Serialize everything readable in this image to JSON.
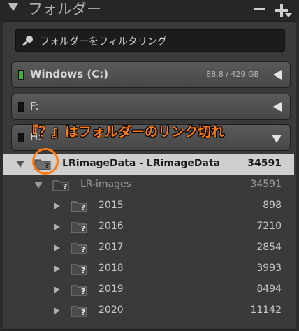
{
  "header": {
    "title": "フォルダー"
  },
  "search": {
    "placeholder": "フォルダーをフィルタリング"
  },
  "volumes": [
    {
      "name": "Windows (C:)",
      "size": "88.8 / 429 GB",
      "online": true
    },
    {
      "name": "F:",
      "size": "",
      "online": false
    },
    {
      "name": "H:",
      "size": "",
      "online": false
    }
  ],
  "annotation": "『？』はフォルダーのリンク切れ",
  "tree": {
    "root": {
      "label": "LRimageData - LRimageData",
      "count": "34591"
    },
    "sub": {
      "label": "LR-images",
      "count": "34591"
    },
    "years": [
      {
        "label": "2015",
        "count": "898"
      },
      {
        "label": "2016",
        "count": "7210"
      },
      {
        "label": "2017",
        "count": "2854"
      },
      {
        "label": "2018",
        "count": "3993"
      },
      {
        "label": "2019",
        "count": "8494"
      },
      {
        "label": "2020",
        "count": "11142"
      }
    ]
  },
  "colors": {
    "annotation": "#ff7a10",
    "online": "#3cb53c",
    "selected_row": "#cfcfcf"
  }
}
